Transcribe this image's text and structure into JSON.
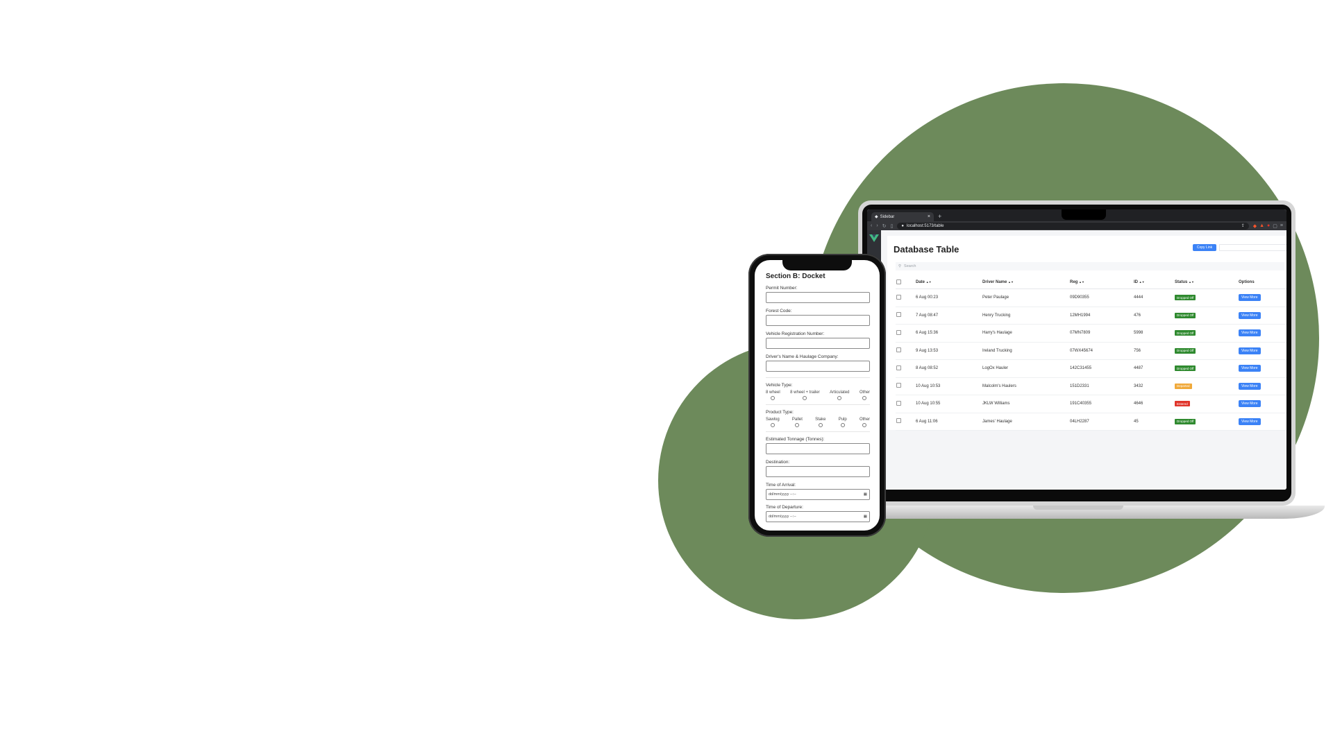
{
  "colors": {
    "accent_green": "#6d8a5b",
    "button_blue": "#3b82f6",
    "dropped_off": "#2f8a2f",
    "departed": "#f0a93a",
    "entered": "#e0352b"
  },
  "browser": {
    "tab_title": "Sidebar",
    "tab_close": "×",
    "new_tab": "+",
    "url": "localhost:5173/table",
    "icons": [
      "back-icon",
      "forward-icon",
      "reload-icon",
      "bookmark-icon",
      "lock-icon",
      "share-icon",
      "brave-shield-icon",
      "brave-rewards-icon",
      "extension-icon",
      "sidebar-icon",
      "menu-icon"
    ]
  },
  "dashboard": {
    "title": "Database Table",
    "copy_link_label": "Copy Link",
    "search_placeholder": "Search",
    "columns": [
      "Date",
      "Driver Name",
      "Reg",
      "ID",
      "Status",
      "Options"
    ],
    "sort_glyph": "▲▼",
    "rows": [
      {
        "date": "6 Aug 00:23",
        "driver": "Peter Paulage",
        "reg": "09D90355",
        "id": "4444",
        "status": "Dropped Off",
        "option": "View More"
      },
      {
        "date": "7 Aug 08:47",
        "driver": "Henry Trucking",
        "reg": "12MH1994",
        "id": "476",
        "status": "Dropped Off",
        "option": "View More"
      },
      {
        "date": "6 Aug 15:36",
        "driver": "Harry's Haulage",
        "reg": "07MN7809",
        "id": "5998",
        "status": "Dropped Off",
        "option": "View More"
      },
      {
        "date": "9 Aug 13:53",
        "driver": "Ireland Trucking",
        "reg": "07WX45674",
        "id": "756",
        "status": "Dropped Off",
        "option": "View More"
      },
      {
        "date": "8 Aug 08:52",
        "driver": "LogOx Hauler",
        "reg": "142C31455",
        "id": "4487",
        "status": "Dropped Off",
        "option": "View More"
      },
      {
        "date": "10 Aug 10:53",
        "driver": "Malcolm's Haulers",
        "reg": "151D2331",
        "id": "3432",
        "status": "Departed",
        "option": "View More"
      },
      {
        "date": "10 Aug 10:55",
        "driver": "JKLW Williams",
        "reg": "191C40355",
        "id": "4646",
        "status": "Entered",
        "option": "View More"
      },
      {
        "date": "6 Aug 11:06",
        "driver": "James' Haulage",
        "reg": "04LH2287",
        "id": "45",
        "status": "Dropped Off",
        "option": "View More"
      }
    ]
  },
  "phone_form": {
    "title": "Section B: Docket",
    "permit_label": "Permit Number:",
    "forest_label": "Forest Code:",
    "vehicle_reg_label": "Vehicle Registration Number:",
    "driver_label": "Driver's Name & Haulage Company:",
    "vehicle_type_label": "Vehicle Type:",
    "vehicle_types": [
      "8 wheel",
      "8 wheel + trailer",
      "Articulated",
      "Other"
    ],
    "product_type_label": "Product Type:",
    "product_types": [
      "Sawlog",
      "Pallet",
      "Stake",
      "Pulp",
      "Other"
    ],
    "tonnage_label": "Estimated Tonnage (Tonnes):",
    "destination_label": "Destination:",
    "arrival_label": "Time of Arrival:",
    "departure_label": "Time of Departure:",
    "datetime_placeholder": "dd/mm/yyyy --:--"
  }
}
